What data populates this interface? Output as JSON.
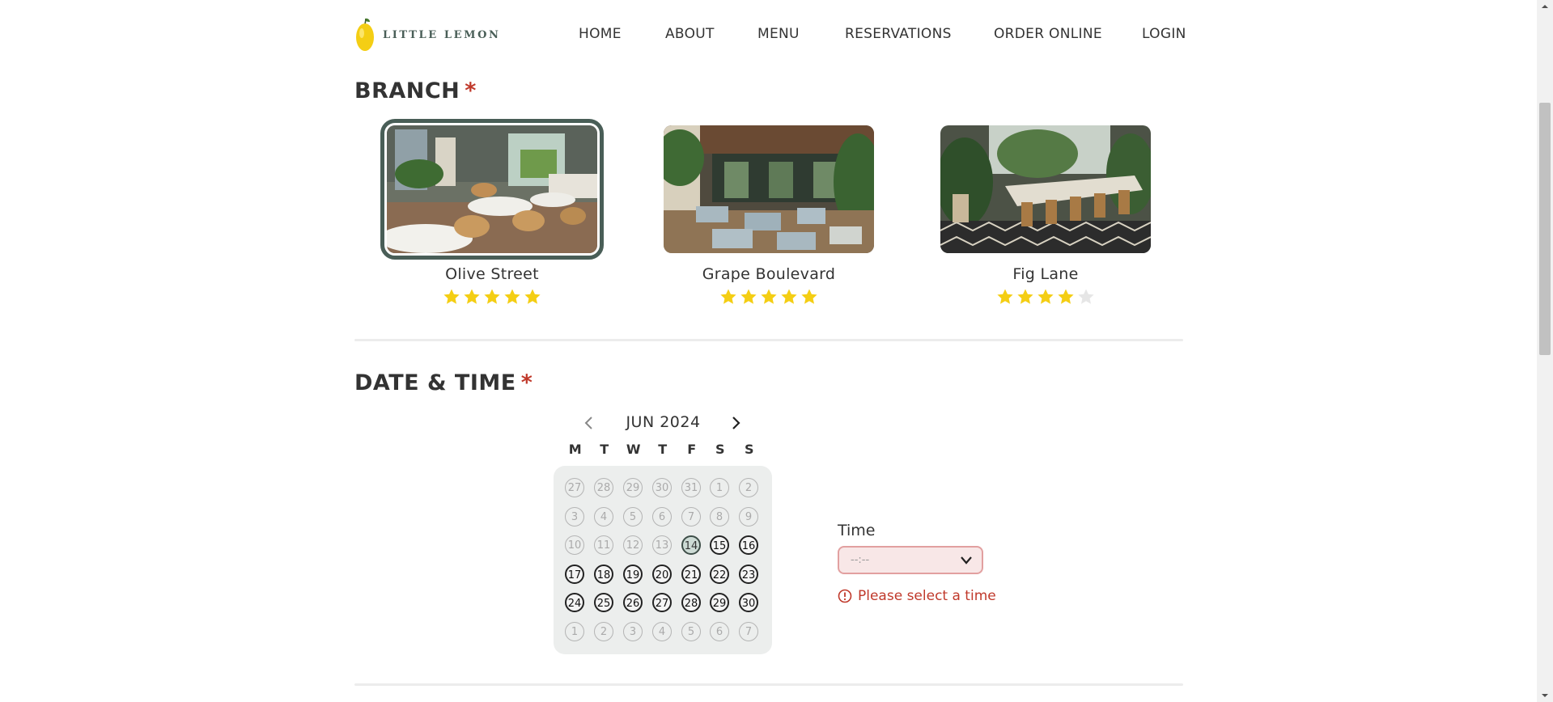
{
  "header": {
    "logo_text": "LITTLE LEMON",
    "nav": [
      "HOME",
      "ABOUT",
      "MENU",
      "RESERVATIONS",
      "ORDER ONLINE",
      "LOGIN"
    ]
  },
  "branch_section": {
    "title": "BRANCH",
    "required_mark": "*",
    "branches": [
      {
        "name": "Olive Street",
        "rating": 5,
        "selected": true
      },
      {
        "name": "Grape Boulevard",
        "rating": 5,
        "selected": false
      },
      {
        "name": "Fig Lane",
        "rating": 4,
        "selected": false
      }
    ]
  },
  "datetime_section": {
    "title": "DATE & TIME",
    "required_mark": "*",
    "calendar": {
      "month_label": "JUN 2024",
      "weekdays": [
        "M",
        "T",
        "W",
        "T",
        "F",
        "S",
        "S"
      ],
      "weeks": [
        [
          "27",
          "28",
          "29",
          "30",
          "31",
          "1",
          "2"
        ],
        [
          "3",
          "4",
          "5",
          "6",
          "7",
          "8",
          "9"
        ],
        [
          "10",
          "11",
          "12",
          "13",
          "14",
          "15",
          "16"
        ],
        [
          "17",
          "18",
          "19",
          "20",
          "21",
          "22",
          "23"
        ],
        [
          "24",
          "25",
          "26",
          "27",
          "28",
          "29",
          "30"
        ],
        [
          "1",
          "2",
          "3",
          "4",
          "5",
          "6",
          "7"
        ]
      ],
      "selected_day": "14",
      "first_available_day": "14"
    },
    "time": {
      "label": "Time",
      "value": "--:--",
      "error": "Please select a time"
    }
  },
  "colors": {
    "primary": "#495E57",
    "star": "#F4CE14",
    "star_empty": "#e6e6e6",
    "error": "#c0392b"
  },
  "icons": {
    "prev": "chevron-left-icon",
    "next": "chevron-right-icon",
    "time_dropdown": "chevron-down-icon",
    "error": "alert-circle-icon",
    "star": "star-icon"
  }
}
